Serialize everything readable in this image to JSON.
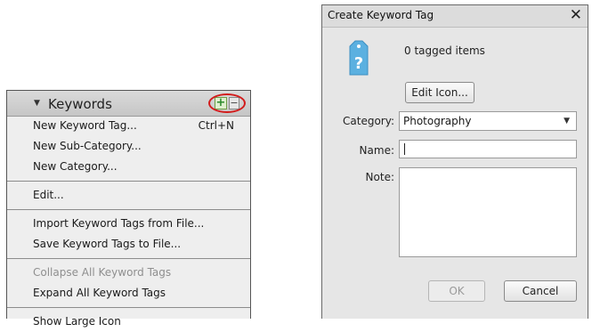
{
  "keywords_panel": {
    "title": "Keywords",
    "header_icons": [
      "collapse-triangle-icon",
      "plus-icon",
      "minus-icon"
    ],
    "highlight_color": "#d21b1b",
    "menu": {
      "new_keyword_tag": "New Keyword Tag...",
      "new_keyword_tag_shortcut": "Ctrl+N",
      "new_sub_category": "New Sub-Category...",
      "new_category": "New Category...",
      "edit": "Edit...",
      "import_tags": "Import Keyword Tags from File...",
      "save_tags": "Save Keyword Tags to File...",
      "collapse_all": "Collapse All Keyword Tags",
      "expand_all": "Expand All Keyword Tags",
      "show_large_icon": "Show Large Icon"
    }
  },
  "dialog": {
    "title": "Create Keyword Tag",
    "close_icon": "close-icon",
    "tag_icon": "question-tag-icon",
    "tag_icon_color": "#4aa3d8",
    "tagged_items": "0 tagged items",
    "edit_icon_label": "Edit Icon...",
    "category_label": "Category:",
    "category_value": "Photography",
    "name_label": "Name:",
    "name_value": "",
    "note_label": "Note:",
    "note_value": "",
    "ok_label": "OK",
    "cancel_label": "Cancel"
  }
}
